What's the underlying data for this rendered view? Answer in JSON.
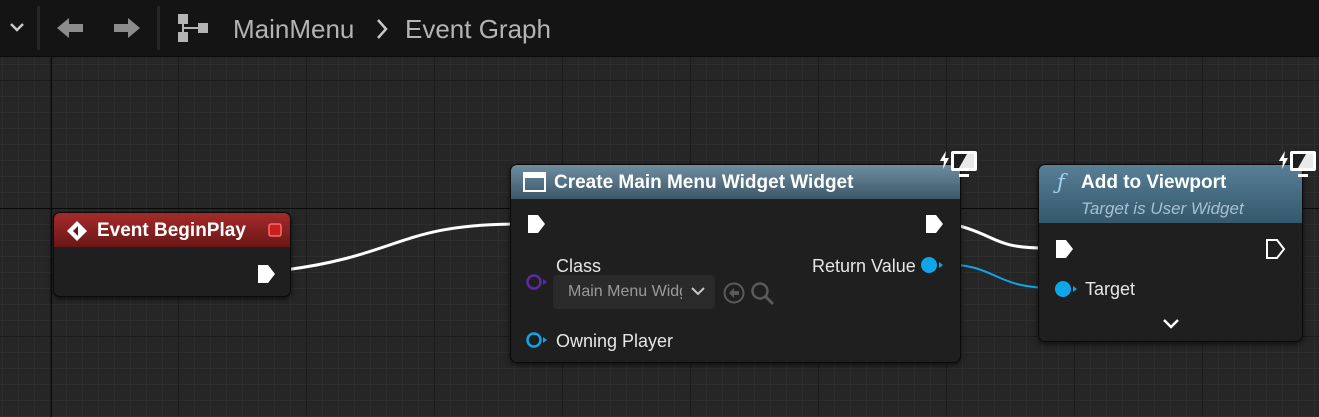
{
  "toolbar": {
    "breadcrumb": [
      "MainMenu",
      "Event Graph"
    ]
  },
  "nodes": {
    "event_begin_play": {
      "title": "Event BeginPlay",
      "header_color": "#8a2020"
    },
    "create_widget": {
      "title": "Create Main Menu Widget Widget",
      "pins": {
        "class_label": "Class",
        "class_value": "Main Menu Widget",
        "owning_player_label": "Owning Player",
        "return_value_label": "Return Value"
      },
      "header_color": "#5e7b8c"
    },
    "add_to_viewport": {
      "title": "Add to Viewport",
      "subtitle": "Target is User Widget",
      "function_glyph": "ƒ",
      "pins": {
        "target_label": "Target"
      },
      "header_color": "#47758e"
    }
  },
  "colors": {
    "object_pin": "#0ea5e9",
    "class_pin": "#5b2ba8",
    "exec_wire": "#ffffff"
  }
}
